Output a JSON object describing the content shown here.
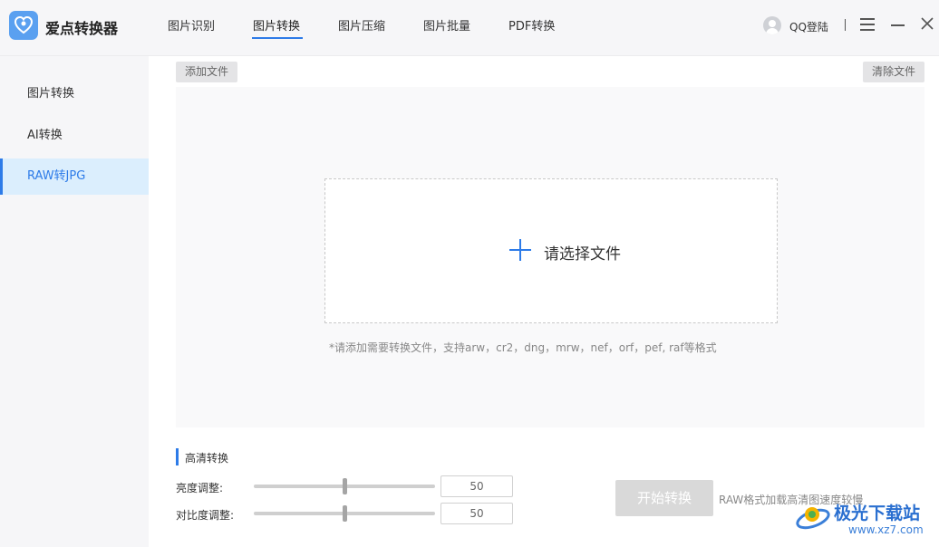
{
  "app": {
    "title": "爱点转换器"
  },
  "nav": {
    "tabs": [
      {
        "label": "图片识别"
      },
      {
        "label": "图片转换"
      },
      {
        "label": "图片压缩"
      },
      {
        "label": "图片批量"
      },
      {
        "label": "PDF转换"
      }
    ],
    "active_index": 1
  },
  "header": {
    "login": "QQ登陆"
  },
  "sidebar": {
    "items": [
      {
        "label": "图片转换"
      },
      {
        "label": "AI转换"
      },
      {
        "label": "RAW转JPG"
      }
    ],
    "active_index": 2
  },
  "toolbar": {
    "add_file": "添加文件",
    "clear_files": "清除文件"
  },
  "dropzone": {
    "label": "请选择文件",
    "hint": "*请添加需要转换文件，支持arw，cr2，dng，mrw，nef，orf，pef, raf等格式"
  },
  "settings": {
    "title": "高清转换",
    "brightness": {
      "label": "亮度调整:",
      "value": "50",
      "fraction": 0.5
    },
    "contrast": {
      "label": "对比度调整:",
      "value": "50",
      "fraction": 0.5
    }
  },
  "actions": {
    "start": "开始转换",
    "note": "RAW格式加载高清图速度较慢"
  },
  "watermark": {
    "name": "极光下载站",
    "url": "www.xz7.com"
  },
  "colors": {
    "accent": "#2d7be8",
    "sidebar_active_bg": "#dbeefd",
    "disabled_button": "#d9d9d9"
  }
}
